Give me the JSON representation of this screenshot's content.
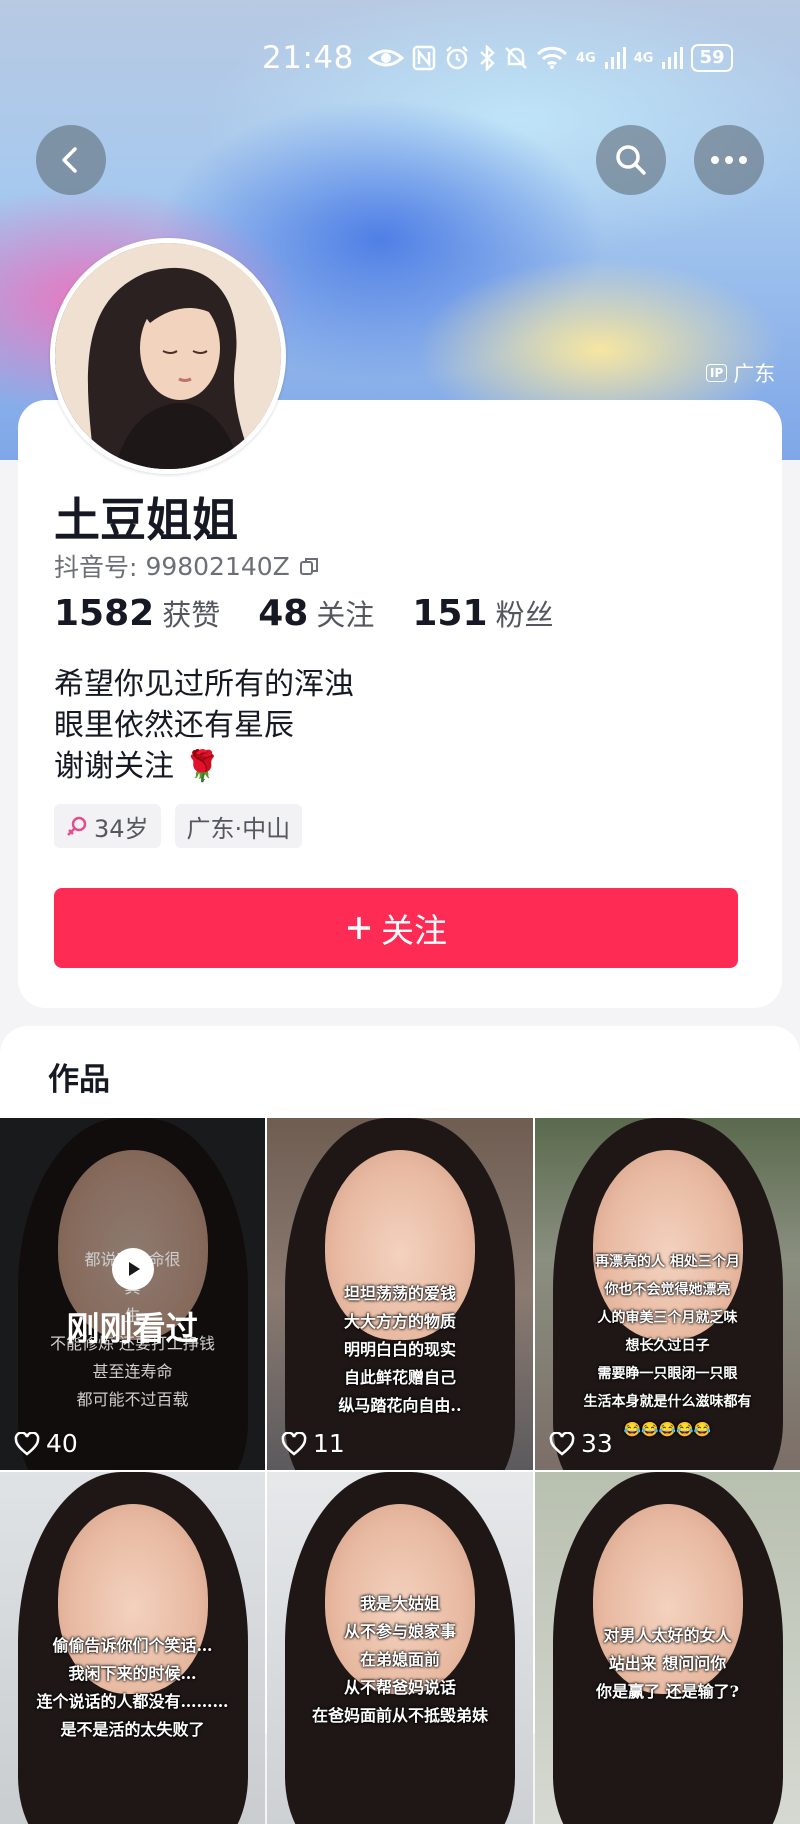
{
  "status_bar": {
    "time": "21:48",
    "signal1": "4G",
    "signal2": "4G",
    "battery": "59"
  },
  "header": {
    "ip_badge": "IP",
    "ip_location": "广东"
  },
  "profile": {
    "name": "土豆姐姐",
    "id_label": "抖音号:",
    "id_value": "99802140Z",
    "stats": [
      {
        "value": "1582",
        "label": "获赞"
      },
      {
        "value": "48",
        "label": "关注"
      },
      {
        "value": "151",
        "label": "粉丝"
      }
    ],
    "bio": [
      "希望你见过所有的浑浊",
      "眼里依然还有星辰",
      "谢谢关注 🌹"
    ],
    "tags": [
      {
        "icon": "female-icon",
        "text": "34岁"
      },
      {
        "text": "广东·中山"
      }
    ],
    "follow_label": "关注",
    "accent": "#fe2c55"
  },
  "works": {
    "title": "作品",
    "recently_watched": "刚刚看过",
    "items": [
      {
        "likes": "40",
        "caption": [
          "都说荒天命很",
          "其",
          "生",
          "不能修炼 还要打工挣钱",
          "甚至连寿命",
          "都可能不过百载"
        ]
      },
      {
        "likes": "11",
        "caption": [
          "坦坦荡荡的爱钱",
          "大大方方的物质",
          "明明白白的现实",
          "自此鲜花赠自己",
          "纵马踏花向自由.."
        ]
      },
      {
        "likes": "33",
        "caption": [
          "再漂亮的人 相处三个月",
          "你也不会觉得她漂亮",
          "人的审美三个月就乏味",
          "想长久过日子",
          "需要睁一只眼闭一只眼",
          "生活本身就是什么滋味都有",
          "😂😂😂😂😂"
        ]
      },
      {
        "likes": "",
        "caption": [
          "偷偷告诉你们个笑话…",
          "我闲下来的时候…",
          "连个说话的人都没有………",
          "是不是活的太失败了"
        ]
      },
      {
        "likes": "",
        "caption": [
          "我是大姑姐",
          "从不参与娘家事",
          "在弟媳面前",
          "从不帮爸妈说话",
          "在爸妈面前从不抵毁弟妹"
        ]
      },
      {
        "likes": "",
        "caption": [
          "对男人太好的女人",
          "站出来 想问问你",
          "你是赢了 还是输了?"
        ]
      }
    ]
  }
}
